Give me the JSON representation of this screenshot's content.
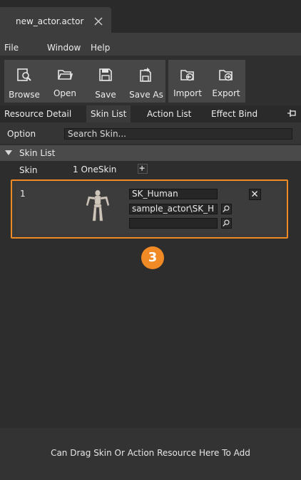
{
  "window": {
    "tab_title": "new_actor.actor"
  },
  "menu": [
    "File",
    "Window",
    "Help"
  ],
  "toolbar": {
    "browse": "Browse",
    "open": "Open",
    "save": "Save",
    "save_as": "Save As",
    "import": "Import",
    "export": "Export"
  },
  "panel_tabs": [
    "Resource Detail",
    "Skin List",
    "Action List",
    "Effect Bind"
  ],
  "active_tab": "Skin List",
  "option": {
    "label": "Option",
    "search_text": "Search Skin..."
  },
  "skin_list": {
    "section_title": "Skin List",
    "skin_label": "Skin",
    "count_text": "1 OneSkin",
    "items": [
      {
        "index": "1",
        "name": "SK_Human",
        "path": "sample_actor\\SK_H",
        "extra": ""
      }
    ]
  },
  "callout_badge": "3",
  "footer_hint": "Can Drag Skin Or Action Resource Here To Add",
  "colors": {
    "accent": "#f08a24",
    "background": "#2d2d2d",
    "panel": "#3d3d3d"
  },
  "icons": {
    "browse": "browse-magnifier-icon",
    "open": "folder-open-icon",
    "save": "floppy-disk-icon",
    "save_as": "floppy-disk-arrow-icon",
    "import": "folder-import-icon",
    "export": "folder-export-icon"
  }
}
